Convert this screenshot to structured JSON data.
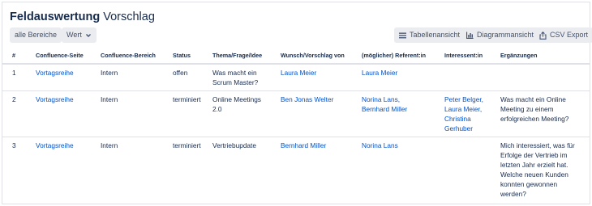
{
  "header": {
    "title_bold": "Feldauswertung",
    "title_rest": "Vorschlag"
  },
  "toolbar": {
    "all_areas_label": "alle Bereiche",
    "value_label": "Wert",
    "table_view_label": "Tabellenansicht",
    "chart_view_label": "Diagrammansicht",
    "csv_export_label": "CSV Export"
  },
  "table": {
    "columns": [
      "#",
      "Confluence-Seite",
      "Confluence-Bereich",
      "Status",
      "Thema/Frage/Idee",
      "Wunsch/Vorschlag von",
      "(möglicher) Referent:in",
      "Interessent:in",
      "Ergänzungen"
    ],
    "rows": [
      {
        "num": "1",
        "page": "Vortagsreihe",
        "area": "Intern",
        "status": "offen",
        "topic": [
          "Was macht ein",
          "Scrum Master?"
        ],
        "proposer": [
          "Laura Meier"
        ],
        "speaker": [
          "Laura Meier"
        ],
        "interested": [],
        "notes": []
      },
      {
        "num": "2",
        "page": "Vortagsreihe",
        "area": "Intern",
        "status": "terminiert",
        "topic": [
          "Online Meetings",
          "2.0"
        ],
        "proposer": [
          "Ben Jonas Welter"
        ],
        "speaker": [
          "Norina Lans,",
          "Bernhard Miller"
        ],
        "interested": [
          "Peter Belger,",
          "Laura Meier,",
          "Christina",
          "Gerhuber"
        ],
        "notes": [
          "Was macht ein Online",
          "Meeting zu einem",
          "erfolgreichen Meeting?"
        ]
      },
      {
        "num": "3",
        "page": "Vortagsreihe",
        "area": "Intern",
        "status": "terminiert",
        "topic": [
          "Vertriebupdate"
        ],
        "proposer": [
          "Bernhard Miller"
        ],
        "speaker": [
          "Norina Lans"
        ],
        "interested": [],
        "notes": [
          "Mich interessiert, was für",
          "Erfolge der Vertrieb im",
          "letzten Jahr erzielt hat.",
          "Welche neuen Kunden",
          "konnten gewonnen",
          "werden?"
        ]
      }
    ]
  },
  "icons": {
    "value_dropdown": "chevron-down-icon",
    "table_view": "list-icon",
    "chart_view": "bar-chart-icon",
    "csv_export": "export-icon"
  },
  "colors": {
    "link": "#0052cc",
    "text": "#172b4d",
    "button_bg": "#ebecf0",
    "border": "#dfe1e6"
  }
}
